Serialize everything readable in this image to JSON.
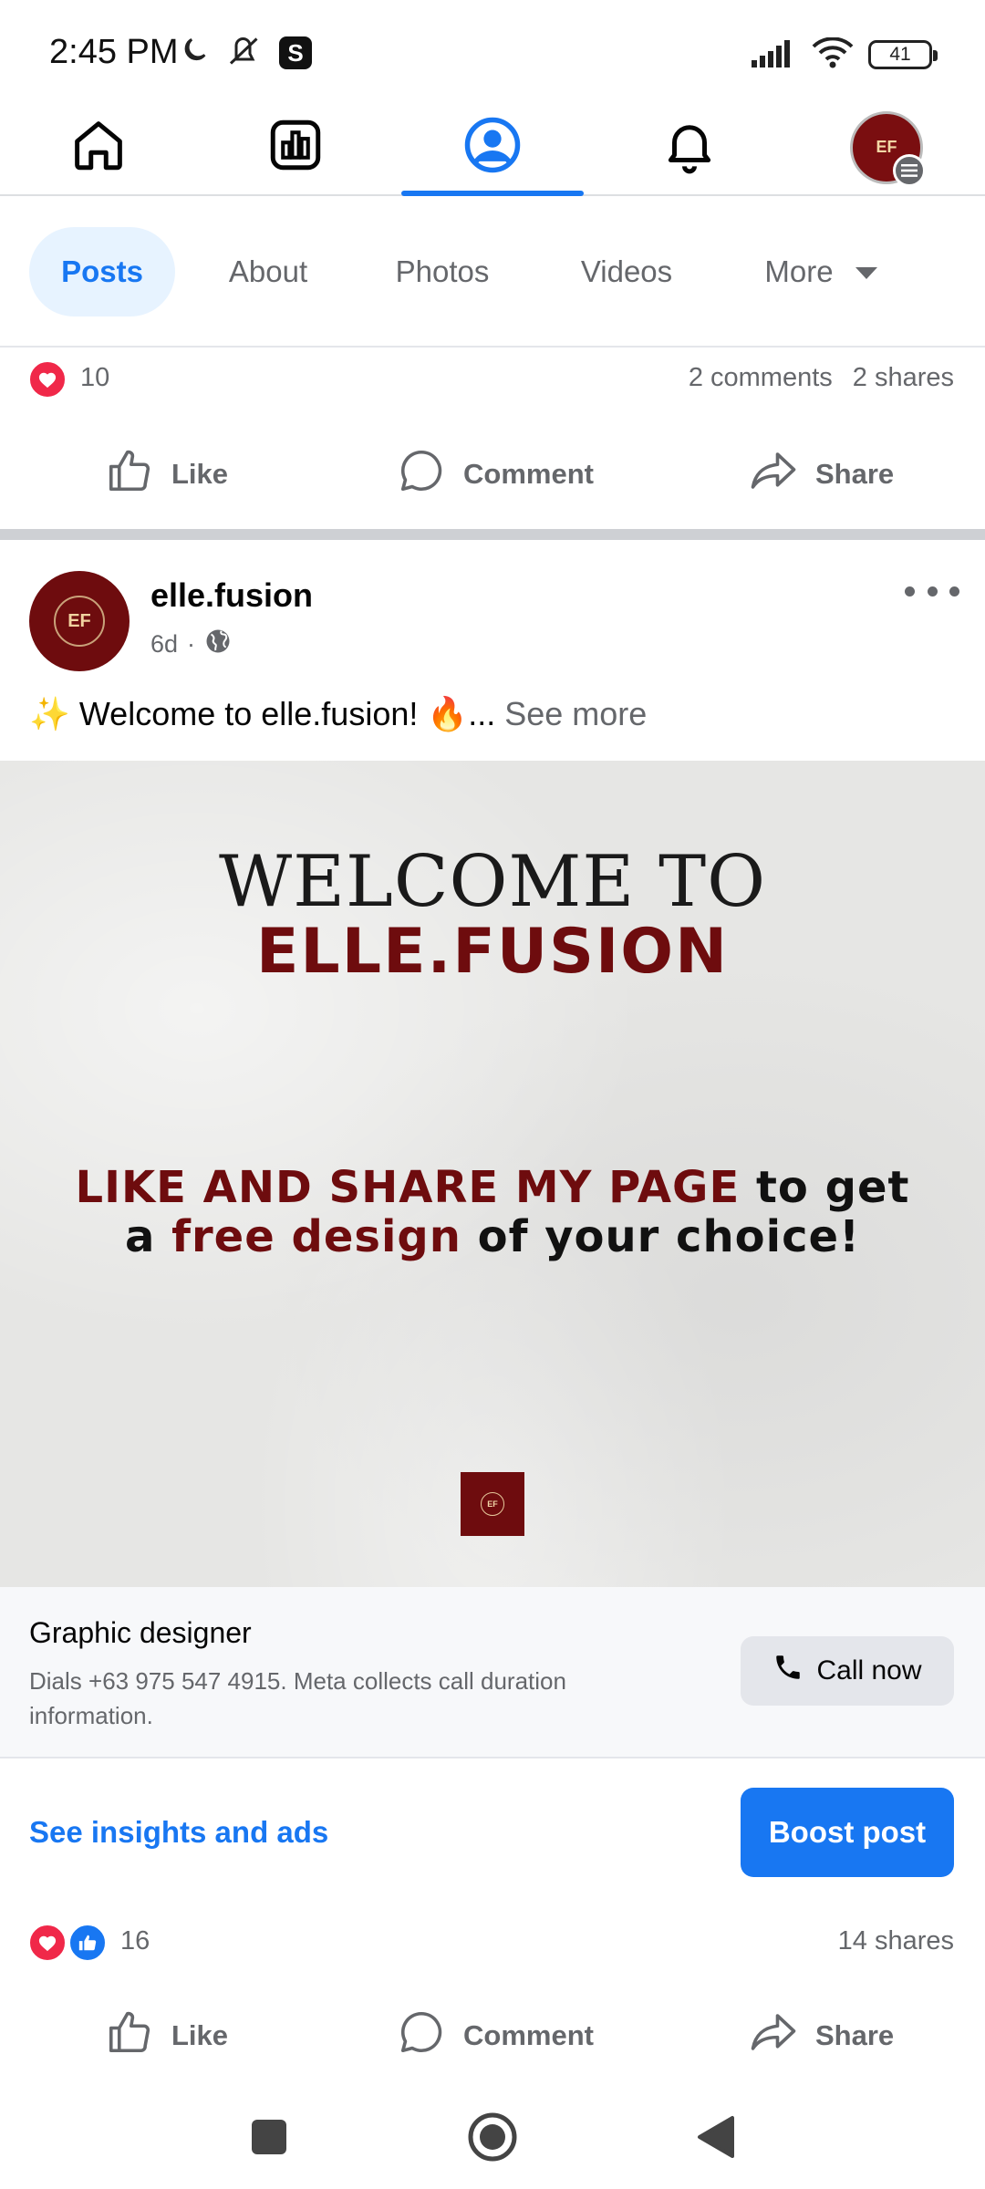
{
  "status_bar": {
    "time": "2:45 PM",
    "battery": "41",
    "app_badge": "S"
  },
  "top_nav": {
    "items": [
      {
        "name": "home",
        "icon": "home-icon"
      },
      {
        "name": "insights",
        "icon": "chart-icon"
      },
      {
        "name": "profile",
        "icon": "profile-icon",
        "active": true
      },
      {
        "name": "notifications",
        "icon": "bell-icon"
      },
      {
        "name": "menu",
        "icon": "avatar-menu"
      }
    ]
  },
  "tabs": [
    {
      "label": "Posts",
      "active": true
    },
    {
      "label": "About"
    },
    {
      "label": "Photos"
    },
    {
      "label": "Videos"
    },
    {
      "label": "More"
    }
  ],
  "prev_post": {
    "reaction_count": "10",
    "comments": "2 comments",
    "shares": "2 shares",
    "actions": {
      "like": "Like",
      "comment": "Comment",
      "share": "Share"
    }
  },
  "post": {
    "author": "elle.fusion",
    "time": "6d",
    "separator": "·",
    "text_sparkle": "✨",
    "text": "Welcome to elle.fusion!",
    "text_fire": "🔥",
    "ellipsis": "...",
    "see_more": "See more",
    "image": {
      "welcome": "WELCOME TO",
      "brand": "ELLE.FUSION",
      "line1_red": "LIKE AND SHARE MY PAGE",
      "line1_black": "to get",
      "line2_black_a": "a",
      "line2_red": "free design",
      "line2_black_b": "of your choice!"
    },
    "cta": {
      "title": "Graphic designer",
      "description": "Dials +63 975 547 4915. Meta collects call duration information.",
      "button": "Call now"
    },
    "insights_link": "See insights and ads",
    "boost_button": "Boost post",
    "reaction_count": "16",
    "shares": "14 shares",
    "actions": {
      "like": "Like",
      "comment": "Comment",
      "share": "Share"
    }
  },
  "colors": {
    "accent": "#1877f2",
    "brand_red": "#6e0c0e",
    "love": "#f02849"
  }
}
